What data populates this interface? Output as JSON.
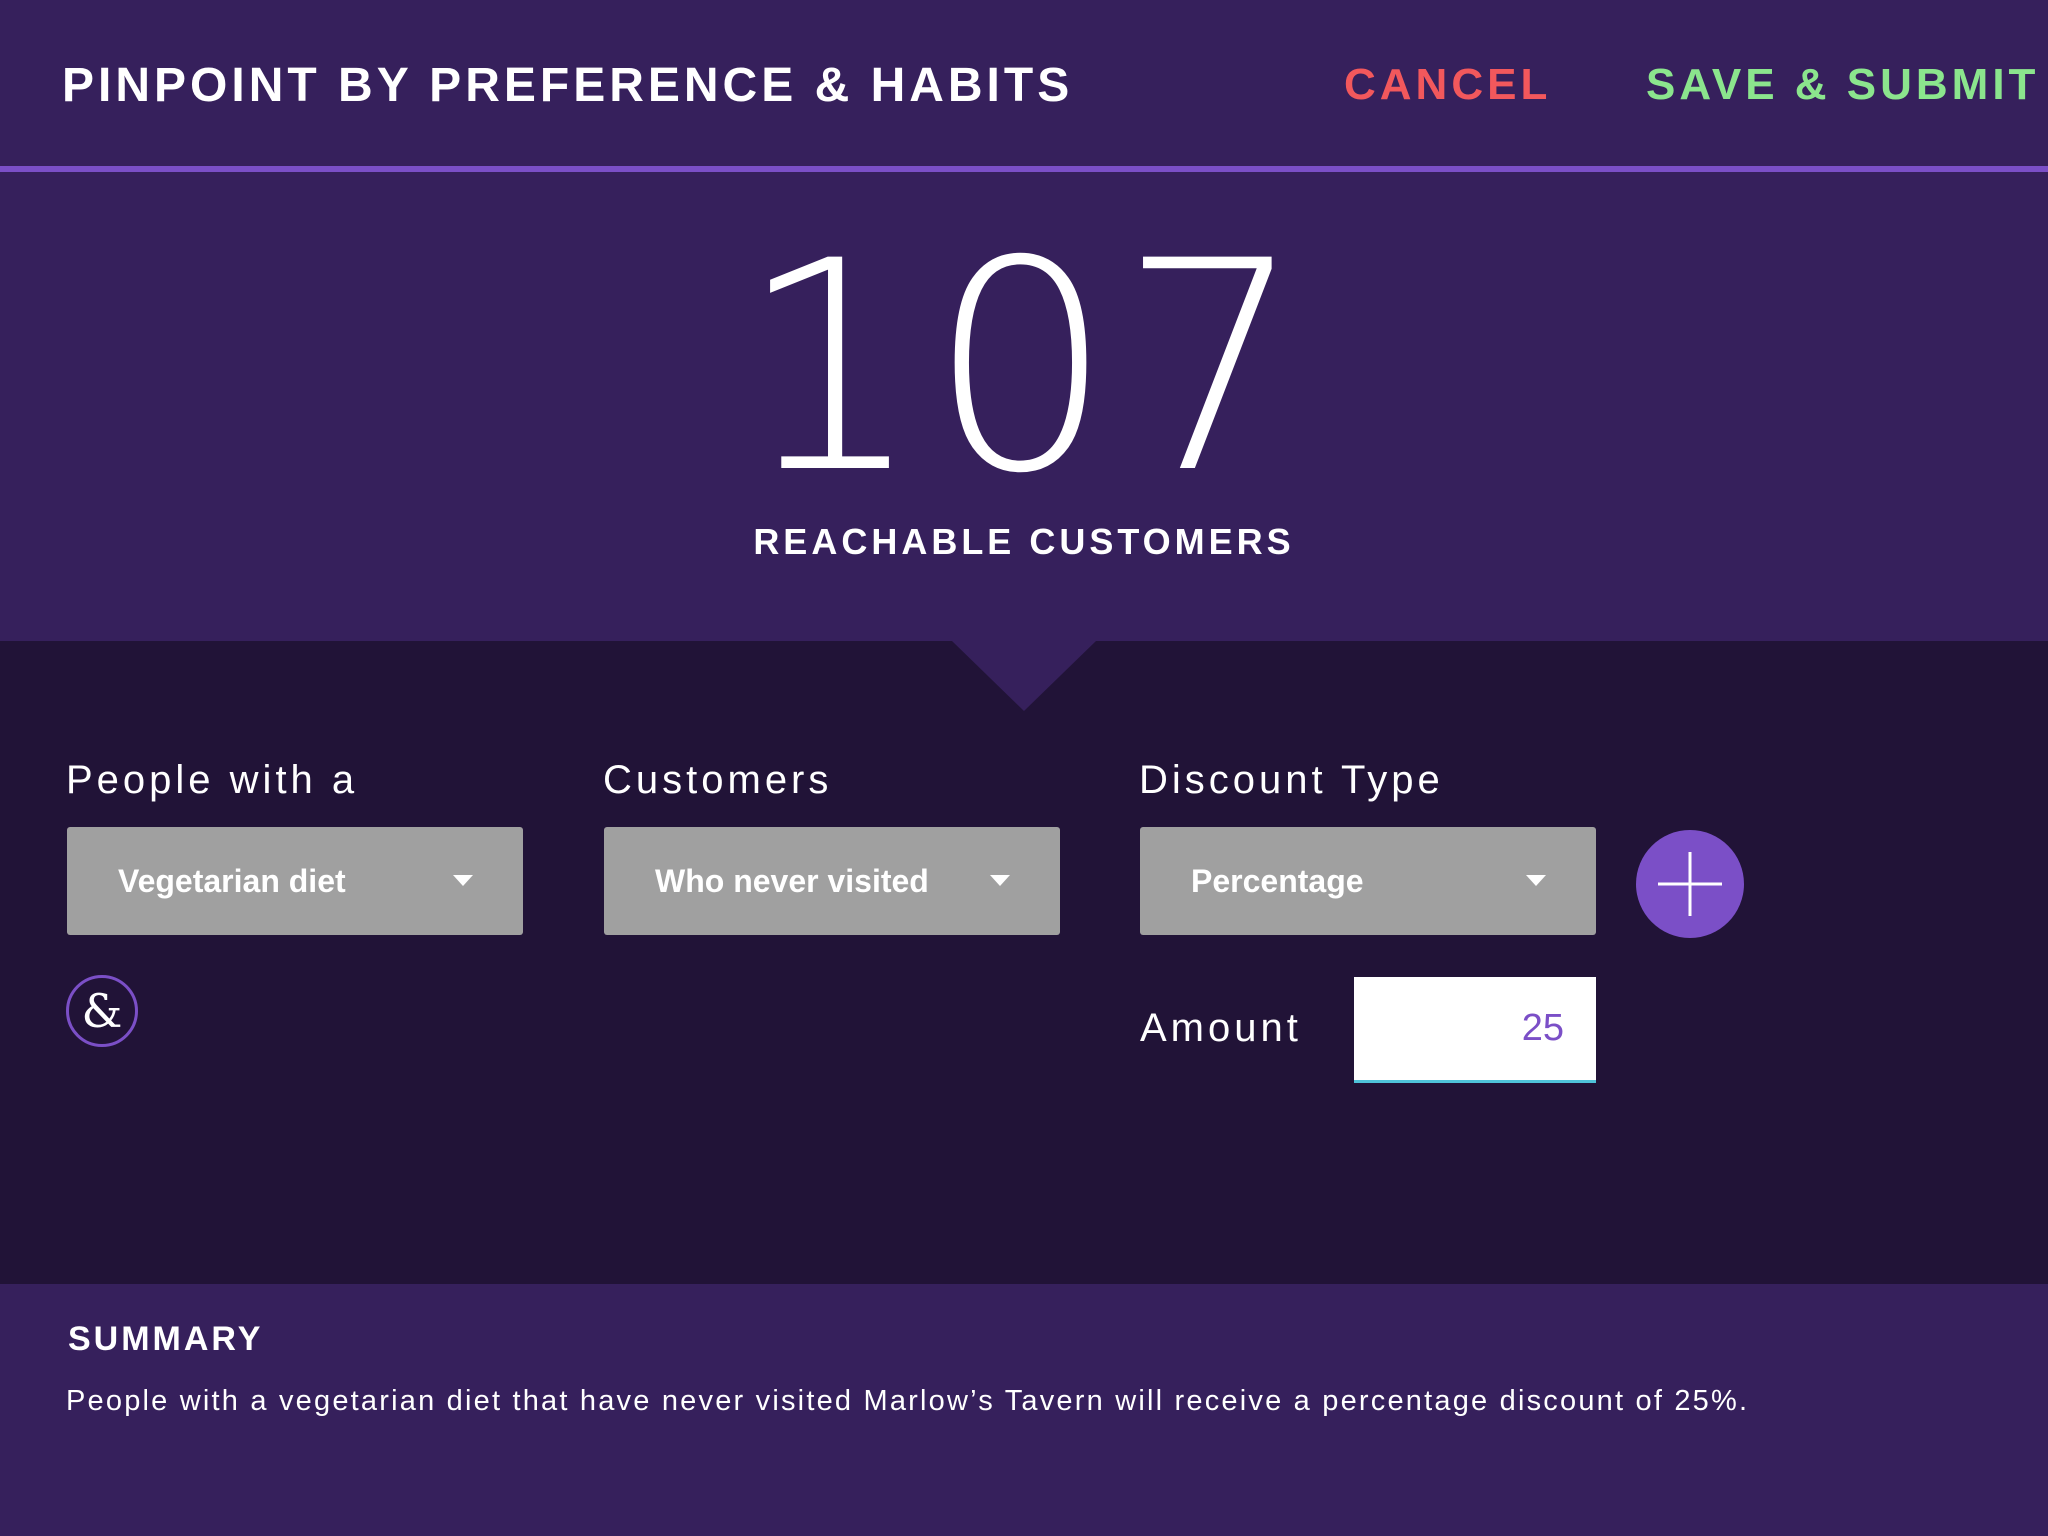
{
  "header": {
    "title": "PINPOINT BY PREFERENCE & HABITS",
    "cancel_label": "CANCEL",
    "save_label": "SAVE & SUBMIT"
  },
  "hero": {
    "count": "107",
    "label": "REACHABLE CUSTOMERS"
  },
  "filters": {
    "people": {
      "label": "People with a",
      "selected": "Vegetarian diet"
    },
    "customers": {
      "label": "Customers",
      "selected": "Who never visited"
    },
    "discount_type": {
      "label": "Discount Type",
      "selected": "Percentage"
    },
    "and_symbol": "&",
    "amount": {
      "label": "Amount",
      "value": "25"
    }
  },
  "summary": {
    "title": "SUMMARY",
    "text": "People with a vegetarian diet that have never visited Marlow’s Tavern will receive a percentage discount of 25%."
  },
  "colors": {
    "header_bg": "#36205c",
    "panel_bg": "#211337",
    "accent_purple": "#7b4fc7",
    "cancel_red": "#f2585c",
    "save_green": "#8be58d",
    "dropdown_gray": "#a0a0a0",
    "input_underline": "#4fc3d9"
  },
  "icons": {
    "dropdown_caret": "chevron-down-icon",
    "add": "plus-icon",
    "and": "ampersand-icon"
  }
}
